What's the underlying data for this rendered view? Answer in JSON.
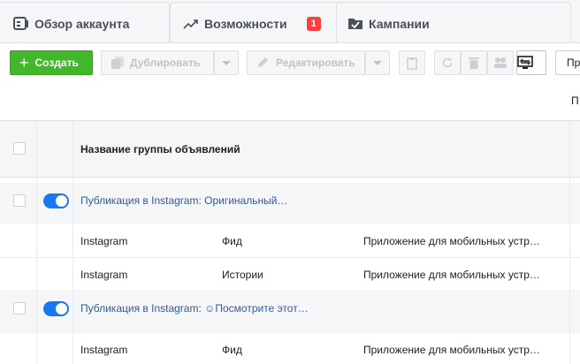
{
  "tabs": [
    {
      "label": "Обзор аккаунта",
      "icon": "account-overview-icon"
    },
    {
      "label": "Возможности",
      "icon": "trend-icon",
      "badge": "1"
    },
    {
      "label": "Кампании",
      "icon": "folder-check-icon"
    }
  ],
  "toolbar": {
    "create": "Создать",
    "duplicate": "Дублировать",
    "edit": "Редактировать",
    "more": "Пр"
  },
  "subhead": {
    "truncated": "П"
  },
  "table": {
    "header": "Название группы объявлений",
    "groups": [
      {
        "name": "Публикация в Instagram: Оригинальный…",
        "active": true,
        "ads": [
          {
            "platform": "Instagram",
            "placement": "Фид",
            "device": "Приложение для мобильных устр…"
          },
          {
            "platform": "Instagram",
            "placement": "Истории",
            "device": "Приложение для мобильных устр…"
          }
        ]
      },
      {
        "name": "Публикация в Instagram: ☺Посмотрите этот…",
        "active": true,
        "ads": [
          {
            "platform": "Instagram",
            "placement": "Фид",
            "device": "Приложение для мобильных устр…"
          }
        ]
      }
    ]
  },
  "colors": {
    "create": "#42b72a",
    "toggle": "#1877f2",
    "link": "#385898",
    "badge": "#fa3e3e"
  }
}
